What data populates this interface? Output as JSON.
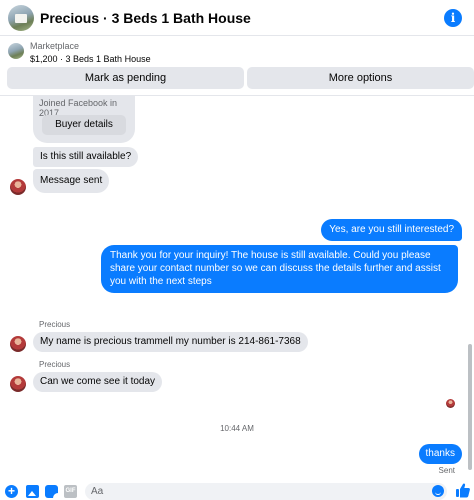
{
  "header": {
    "title": "Precious · 3 Beds 1 Bath House",
    "info_glyph": "i"
  },
  "listing": {
    "label": "Marketplace",
    "price_title": "$1,200 · 3 Beds 1 Bath House"
  },
  "actions": {
    "mark_pending": "Mark as pending",
    "more_options": "More options"
  },
  "profile_card": {
    "joined": "Joined Facebook in 2017",
    "buyer_details": "Buyer details"
  },
  "messages": {
    "still_available": "Is this still available?",
    "message_sent": "Message sent",
    "still_interested": "Yes, are you still interested?",
    "long_reply": "Thank you for your inquiry! The house is still available. Could you please share your contact number so we can discuss the details further and assist you with the next steps",
    "sender_1": "Precious",
    "number_msg": "My name is precious trammell my number is 214-861-7368",
    "sender_2": "Precious",
    "come_see": "Can we come see it today",
    "timestamp": "10:44 AM",
    "thanks": "thanks",
    "sent_status": "Sent"
  },
  "composer": {
    "placeholder": "Aa",
    "gif_label": "GIF"
  },
  "colors": {
    "accent": "#0a7cff",
    "bubble_in": "#e4e6eb"
  }
}
